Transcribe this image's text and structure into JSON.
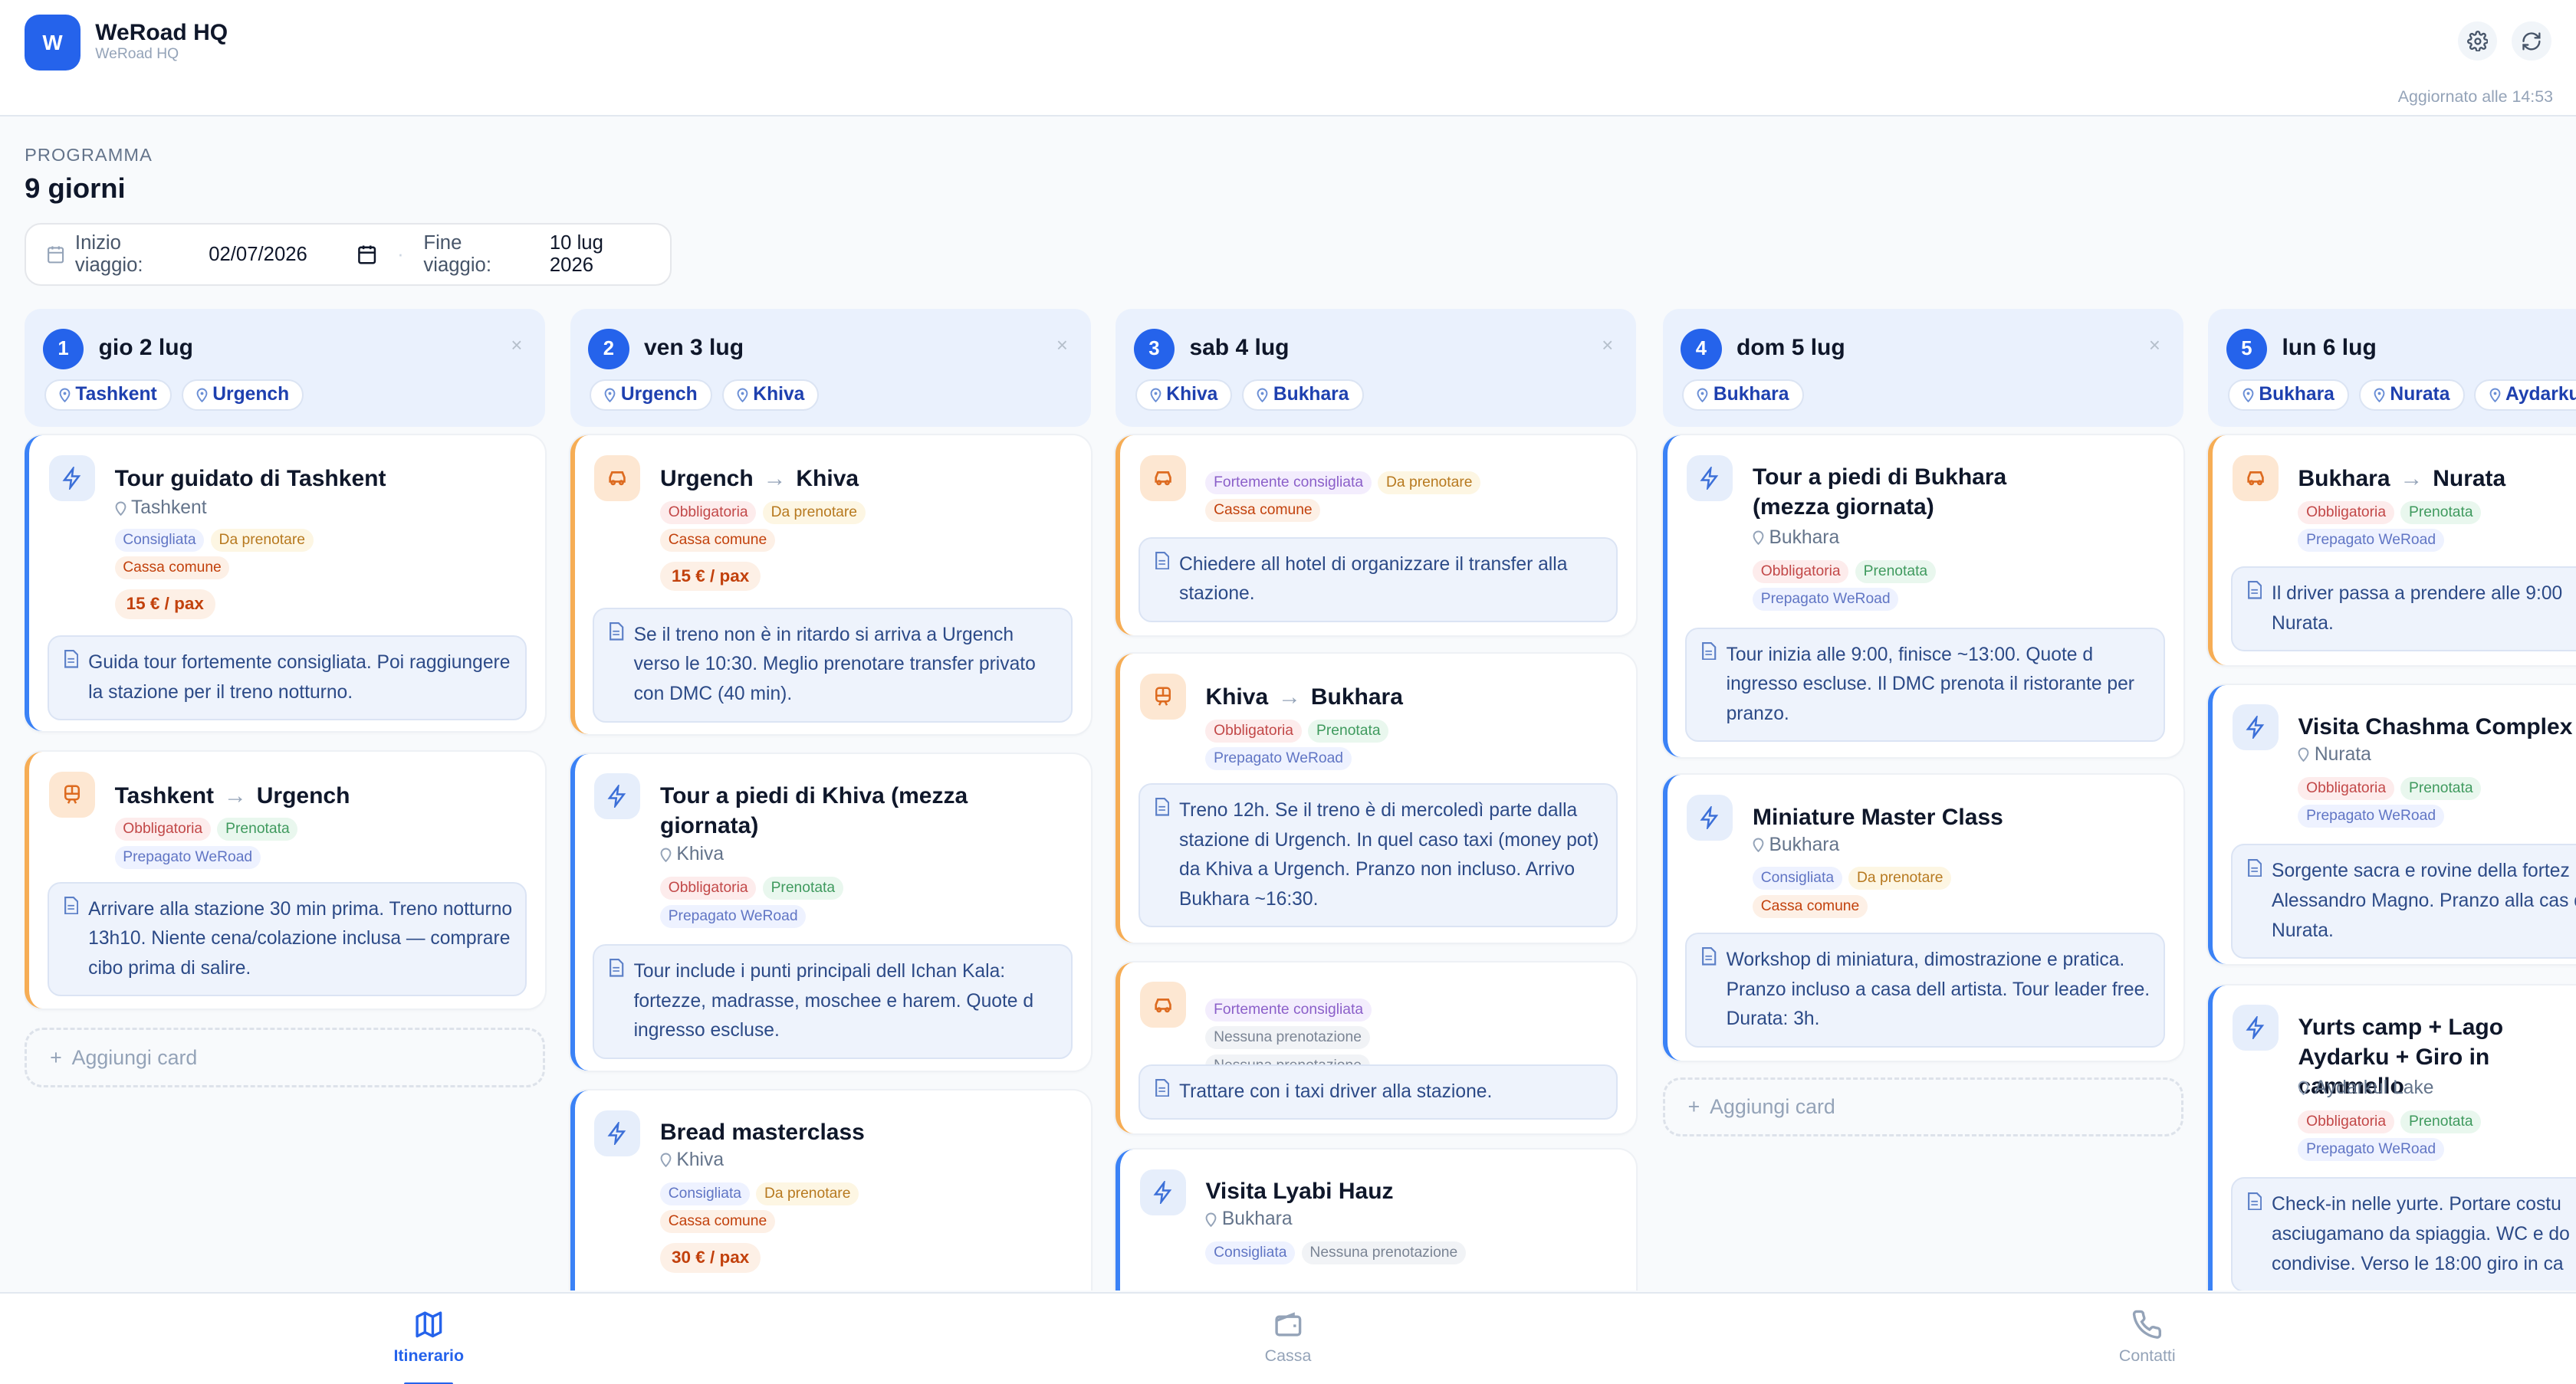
{
  "app": {
    "logo_letter": "W",
    "title": "WeRoad HQ",
    "subtitle": "WeRoad HQ",
    "updated": "Aggiornato alle 14:53"
  },
  "program": {
    "label": "PROGRAMMA",
    "title": "9 giorni",
    "start_label": "Inizio viaggio:",
    "start_value": "02/07/2026",
    "end_label": "Fine viaggio:",
    "end_value": "10 lug 2026",
    "separator": "·"
  },
  "colors": {
    "accent": "#2563eb",
    "note_bg": "#eef3fc",
    "tab_active": "#2563eb"
  },
  "days": [
    {
      "num": "1",
      "title": "gio 2 lug",
      "close": "×",
      "places": [
        "Tashkent",
        "Urgench"
      ],
      "cards": [
        {
          "kind": "activity",
          "title": "Tour guidato di Tashkent",
          "location": "Tashkent",
          "tags": [
            {
              "t": "Consigliata",
              "c": "blue"
            },
            {
              "t": "Da prenotare",
              "c": "yellow"
            },
            {
              "t": "Cassa comune",
              "c": "orange"
            }
          ],
          "price": "15 € / pax",
          "note": "Guida tour fortemente consigliata. Poi raggiungere la stazione per il treno notturno."
        },
        {
          "kind": "train",
          "from": "Tashkent",
          "to": "Urgench",
          "tags": [
            {
              "t": "Obbligatoria",
              "c": "red"
            },
            {
              "t": "Prenotata",
              "c": "green"
            },
            {
              "t": "Prepagato WeRoad",
              "c": "blue"
            }
          ],
          "note": "Arrivare alla stazione 30 min prima. Treno notturno 13h10. Niente cena/colazione inclusa — comprare cibo prima di salire."
        }
      ],
      "add": "Aggiungi card"
    },
    {
      "num": "2",
      "title": "ven 3 lug",
      "close": "×",
      "places": [
        "Urgench",
        "Khiva"
      ],
      "cards": [
        {
          "kind": "car",
          "from": "Urgench",
          "to": "Khiva",
          "tags": [
            {
              "t": "Obbligatoria",
              "c": "red"
            },
            {
              "t": "Da prenotare",
              "c": "yellow"
            },
            {
              "t": "Cassa comune",
              "c": "orange"
            }
          ],
          "price": "15 € / pax",
          "note": "Se il treno non è in ritardo si arriva a Urgench verso le 10:30. Meglio prenotare transfer privato con DMC (40 min)."
        },
        {
          "kind": "activity",
          "title": "Tour a piedi di Khiva (mezza giornata)",
          "location": "Khiva",
          "tags": [
            {
              "t": "Obbligatoria",
              "c": "red"
            },
            {
              "t": "Prenotata",
              "c": "green"
            },
            {
              "t": "Prepagato WeRoad",
              "c": "blue"
            }
          ],
          "note": "Tour include i punti principali dell Ichan Kala: fortezze, madrasse, moschee e harem. Quote d ingresso escluse."
        },
        {
          "kind": "activity",
          "title": "Bread masterclass",
          "location": "Khiva",
          "tags": [
            {
              "t": "Consigliata",
              "c": "blue"
            },
            {
              "t": "Da prenotare",
              "c": "yellow"
            },
            {
              "t": "Cassa comune",
              "c": "orange"
            }
          ],
          "price": "30 € / pax"
        }
      ]
    },
    {
      "num": "3",
      "title": "sab 4 lug",
      "close": "×",
      "places": [
        "Khiva",
        "Bukhara"
      ],
      "cards": [
        {
          "kind": "car",
          "tags": [
            {
              "t": "Fortemente consigliata",
              "c": "purple"
            },
            {
              "t": "Da prenotare",
              "c": "yellow"
            },
            {
              "t": "Cassa comune",
              "c": "orange"
            }
          ],
          "note": "Chiedere all hotel di organizzare il transfer alla stazione."
        },
        {
          "kind": "train",
          "from": "Khiva",
          "to": "Bukhara",
          "tags": [
            {
              "t": "Obbligatoria",
              "c": "red"
            },
            {
              "t": "Prenotata",
              "c": "green"
            },
            {
              "t": "Prepagato WeRoad",
              "c": "blue"
            }
          ],
          "note": "Treno 12h. Se il treno è di mercoledì parte dalla stazione di Urgench. In quel caso taxi (money pot) da Khiva a Urgench. Pranzo non incluso. Arrivo Bukhara ~16:30."
        },
        {
          "kind": "car",
          "tags": [
            {
              "t": "Fortemente consigliata",
              "c": "purple"
            },
            {
              "t": "Nessuna prenotazione",
              "c": "gray"
            },
            {
              "t": "Cassa comune",
              "c": "orange"
            }
          ],
          "note": "Trattare con i taxi driver alla stazione."
        },
        {
          "kind": "activity",
          "title": "Visita Lyabi Hauz",
          "location": "Bukhara",
          "tags": [
            {
              "t": "Consigliata",
              "c": "blue"
            },
            {
              "t": "Nessuna prenotazione",
              "c": "gray"
            }
          ]
        }
      ]
    },
    {
      "num": "4",
      "title": "dom 5 lug",
      "close": "×",
      "places": [
        "Bukhara"
      ],
      "cards": [
        {
          "kind": "activity",
          "title": "Tour a piedi di Bukhara (mezza giornata)",
          "location": "Bukhara",
          "tags": [
            {
              "t": "Obbligatoria",
              "c": "red"
            },
            {
              "t": "Prenotata",
              "c": "green"
            },
            {
              "t": "Prepagato WeRoad",
              "c": "blue"
            }
          ],
          "note": "Tour inizia alle 9:00, finisce ~13:00. Quote d ingresso escluse. Il DMC prenota il ristorante per pranzo."
        },
        {
          "kind": "activity",
          "title": "Miniature Master Class",
          "location": "Bukhara",
          "tags": [
            {
              "t": "Consigliata",
              "c": "blue"
            },
            {
              "t": "Da prenotare",
              "c": "yellow"
            },
            {
              "t": "Cassa comune",
              "c": "orange"
            }
          ],
          "note": "Workshop di miniatura, dimostrazione e pratica. Pranzo incluso a casa dell artista. Tour leader free. Durata: 3h."
        }
      ],
      "add": "Aggiungi card"
    },
    {
      "num": "5",
      "title": "lun 6 lug",
      "close": "×",
      "places": [
        "Bukhara",
        "Nurata",
        "Aydarku"
      ],
      "cards": [
        {
          "kind": "car",
          "from": "Bukhara",
          "to": "Nurata",
          "tags": [
            {
              "t": "Obbligatoria",
              "c": "red"
            },
            {
              "t": "Prenotata",
              "c": "green"
            },
            {
              "t": "Prepagato WeRoad",
              "c": "blue"
            }
          ],
          "note": "Il driver passa a prendere alle 9:00 Nurata."
        },
        {
          "kind": "activity",
          "title": "Visita Chashma Complex",
          "location": "Nurata",
          "tags": [
            {
              "t": "Obbligatoria",
              "c": "red"
            },
            {
              "t": "Prenotata",
              "c": "green"
            },
            {
              "t": "Prepagato WeRoad",
              "c": "blue"
            }
          ],
          "note": "Sorgente sacra e rovine della fortez Alessandro Magno. Pranzo alla cas di Nurata."
        },
        {
          "kind": "activity",
          "title": "Yurts camp + Lago Aydarku + Giro in cammello",
          "location": "Aydarkul Lake",
          "tags": [
            {
              "t": "Obbligatoria",
              "c": "red"
            },
            {
              "t": "Prenotata",
              "c": "green"
            },
            {
              "t": "Prepagato WeRoad",
              "c": "blue"
            }
          ],
          "note": "Check-in nelle yurte. Portare costu asciugamano da spiaggia. WC e do condivise. Verso le 18:00 giro in ca"
        }
      ]
    }
  ],
  "tabs": [
    {
      "label": "Itinerario",
      "icon": "map-icon",
      "active": true
    },
    {
      "label": "Cassa",
      "icon": "wallet-icon",
      "active": false
    },
    {
      "label": "Contatti",
      "icon": "phone-icon",
      "active": false
    }
  ]
}
